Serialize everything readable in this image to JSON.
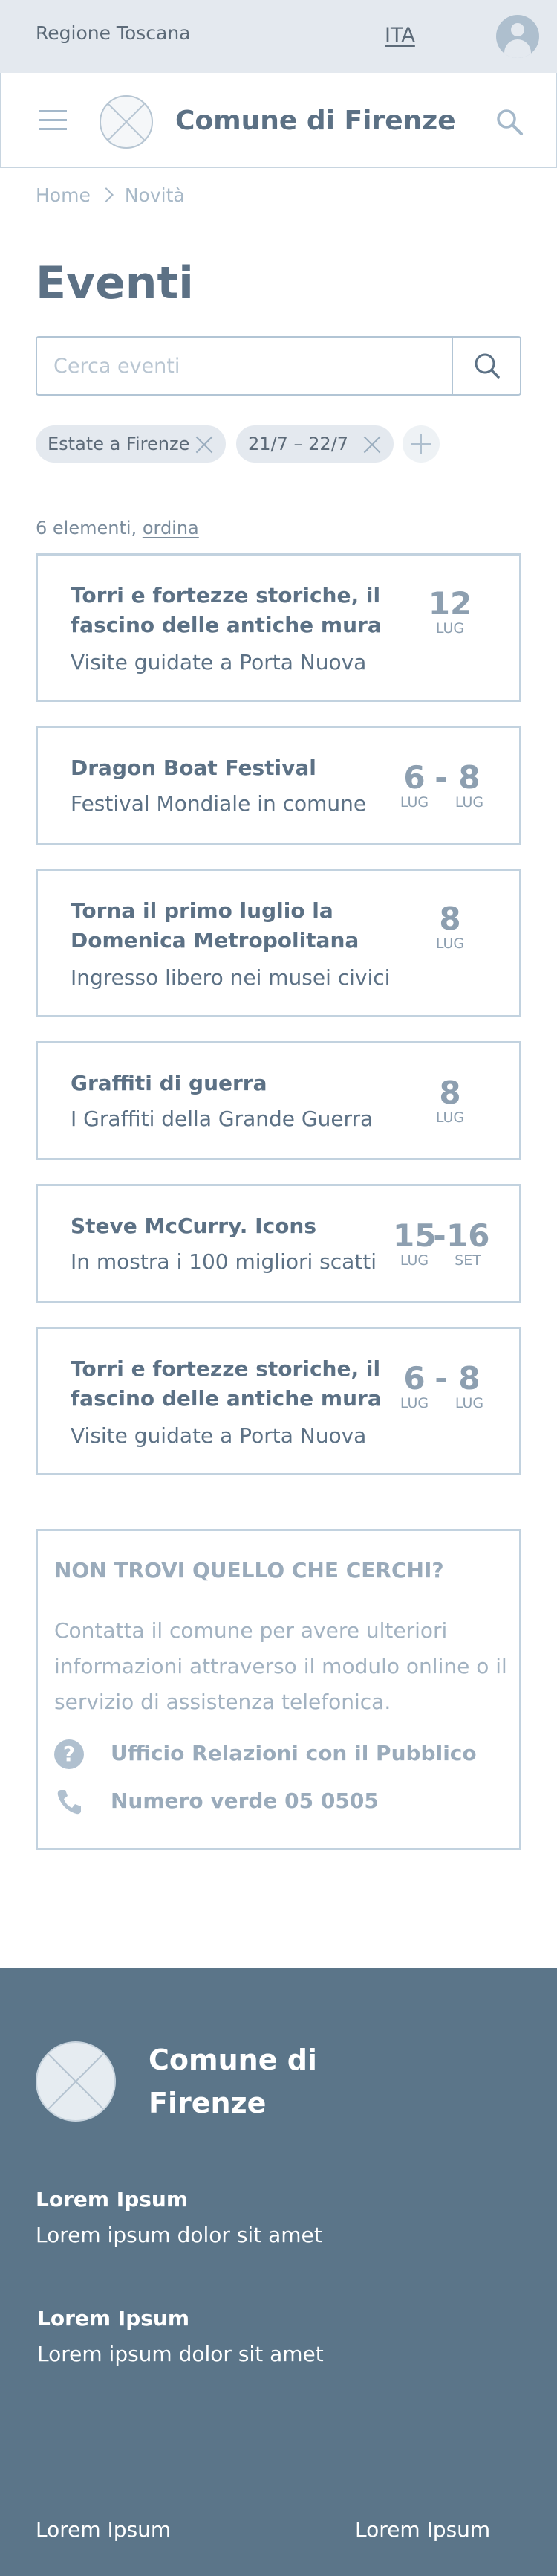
{
  "topbar": {
    "region": "Regione Toscana",
    "language": "ITA",
    "user_icon": "user-icon"
  },
  "header": {
    "site_title": "Comune di Firenze",
    "menu_icon": "hamburger-icon",
    "search_icon": "search-icon"
  },
  "breadcrumb": {
    "items": [
      "Home",
      "Novità"
    ]
  },
  "page": {
    "title": "Eventi"
  },
  "search": {
    "placeholder": "Cerca eventi",
    "value": ""
  },
  "filters": {
    "chips": [
      "Estate a Firenze",
      "21/7 – 22/7"
    ],
    "add_icon": "plus-icon"
  },
  "results": {
    "count": "6 elementi,",
    "sort_label": "ordina"
  },
  "events": [
    {
      "title": "Torri e fortezze storiche, il fascino delle antiche mura",
      "subtitle": "Visite guidate a Porta Nuova",
      "start_day": "12",
      "start_month": "LUG"
    },
    {
      "title": "Dragon Boat Festival",
      "subtitle": "Festival Mondiale in comune",
      "start_day": "6",
      "start_month": "LUG",
      "end_day": "8",
      "end_month": "LUG"
    },
    {
      "title": "Torna il primo luglio la Domenica Metropolitana",
      "subtitle": "Ingresso libero nei musei civici",
      "start_day": "8",
      "start_month": "LUG"
    },
    {
      "title": "Graffiti di guerra",
      "subtitle": "I Graffiti della Grande Guerra",
      "start_day": "8",
      "start_month": "LUG"
    },
    {
      "title": "Steve McCurry. Icons",
      "subtitle": "In mostra i 100 migliori scatti",
      "start_day": "15",
      "start_month": "LUG",
      "end_day": "16",
      "end_month": "SET"
    },
    {
      "title": "Torri e fortezze storiche, il fascino delle antiche mura",
      "subtitle": "Visite guidate a Porta Nuova",
      "start_day": "6",
      "start_month": "LUG",
      "end_day": "8",
      "end_month": "LUG"
    }
  ],
  "contacts": {
    "heading": "NON TROVI QUELLO CHE CERCHI?",
    "text": "Contatta il comune per avere ulteriori informazioni attraverso il modulo online o il servizio di assistenza telefonica.",
    "links": [
      {
        "icon": "question-icon",
        "label": "Ufficio Relazioni con il Pubblico"
      },
      {
        "icon": "phone-icon",
        "label": "Numero verde 05 0505"
      }
    ]
  },
  "footer": {
    "title": "Comune di Firenze",
    "blocks": [
      {
        "heading": "Lorem Ipsum",
        "text": "Lorem ipsum dolor sit amet"
      },
      {
        "heading": "Lorem Ipsum",
        "text": "Lorem ipsum dolor sit amet"
      }
    ],
    "bottom_links": [
      "Lorem Ipsum",
      "Lorem Ipsum"
    ]
  }
}
